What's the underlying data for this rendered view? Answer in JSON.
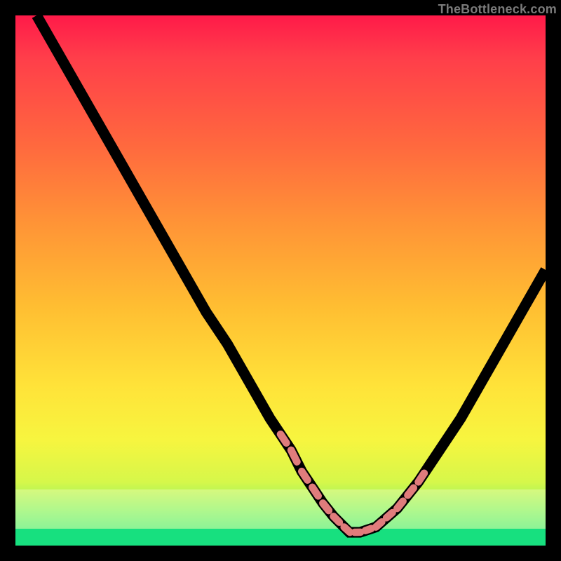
{
  "watermark": "TheBottleneck.com",
  "colors": {
    "frame": "#000000",
    "curve_stroke": "#000000",
    "dash_stroke": "#e07c7c",
    "gradient_top": "#ff1a49",
    "gradient_bottom": "#1de585"
  },
  "chart_data": {
    "type": "line",
    "title": "",
    "xlabel": "",
    "ylabel": "",
    "xlim": [
      0,
      100
    ],
    "ylim": [
      0,
      100
    ],
    "grid": false,
    "series": [
      {
        "name": "bottleneck-curve",
        "x": [
          4,
          8,
          12,
          16,
          20,
          24,
          28,
          32,
          36,
          40,
          44,
          48,
          50,
          52,
          54,
          56,
          58,
          60,
          62,
          63,
          65,
          68,
          72,
          76,
          80,
          84,
          88,
          92,
          96,
          100
        ],
        "y": [
          100,
          93,
          86,
          79,
          72,
          65,
          58,
          51,
          44,
          38,
          31,
          24,
          21,
          18,
          14,
          11,
          8,
          5.5,
          3.5,
          2.5,
          2.5,
          3.5,
          7,
          12,
          18,
          24,
          31,
          38,
          45,
          52
        ]
      }
    ],
    "dash_markers": {
      "name": "threshold-dashes",
      "left_arm": {
        "x_range": [
          50,
          60
        ],
        "y_range": [
          6,
          21
        ]
      },
      "right_arm": {
        "x_range": [
          68,
          78
        ],
        "y_range": [
          4,
          16
        ]
      },
      "floor": {
        "x_range": [
          58,
          68
        ],
        "y_range": [
          2.5,
          3.5
        ]
      }
    }
  }
}
